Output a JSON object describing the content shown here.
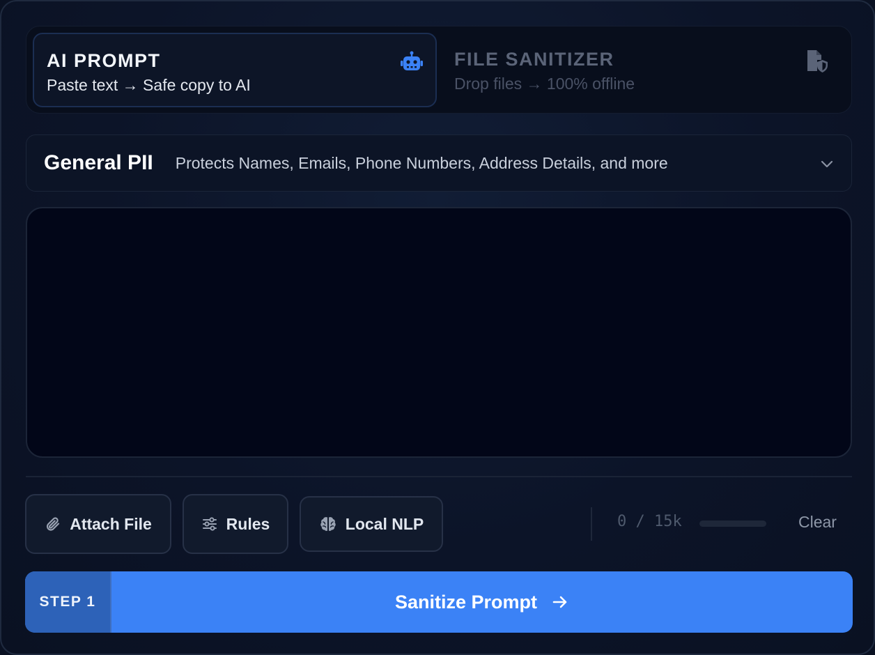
{
  "tabs": [
    {
      "title": "AI PROMPT",
      "subtitle": "Paste text → Safe copy to AI",
      "icon": "robot-icon",
      "active": true
    },
    {
      "title": "FILE SANITIZER",
      "subtitle": "Drop files → 100% offline",
      "icon": "file-shield-icon",
      "active": false
    }
  ],
  "preset": {
    "name": "General PII",
    "description": "Protects Names, Emails, Phone Numbers, Address Details, and more",
    "icon": "chevron-down-icon"
  },
  "editor": {
    "value": "",
    "placeholder": ""
  },
  "toolbar": {
    "attach_label": "Attach File",
    "attach_icon": "paperclip-icon",
    "rules_label": "Rules",
    "rules_icon": "sliders-icon",
    "nlp_label": "Local NLP",
    "nlp_icon": "brain-icon",
    "counter": "0 / 15k",
    "usage_fraction": 0,
    "clear_label": "Clear"
  },
  "action": {
    "step_label": "STEP 1",
    "label": "Sanitize Prompt",
    "icon": "arrow-right-icon"
  },
  "colors": {
    "accent": "#3b82f6",
    "step_badge": "#2d62b8",
    "background": "#0c1428"
  }
}
